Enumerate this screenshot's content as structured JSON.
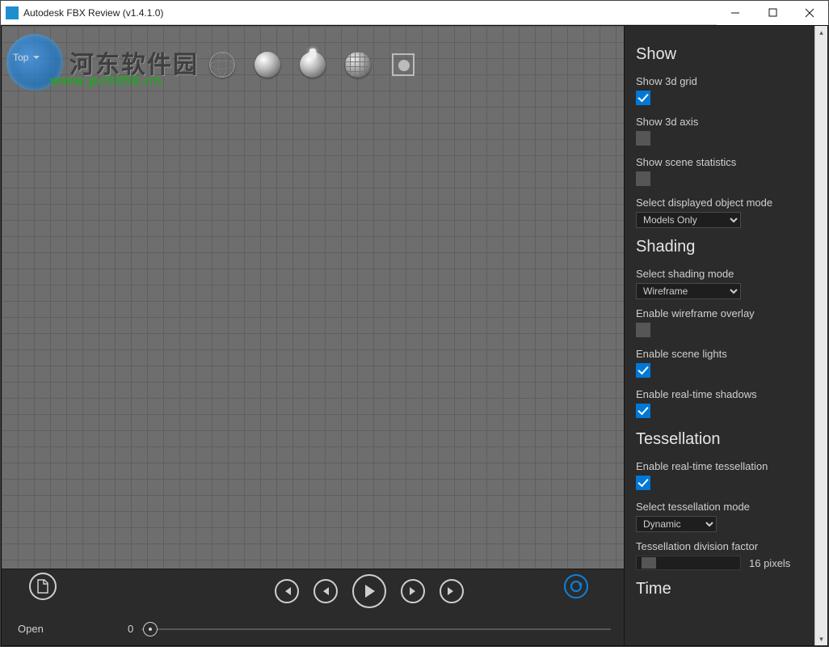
{
  "window": {
    "title": "Autodesk FBX Review (v1.4.1.0)"
  },
  "watermark": {
    "text": "河东软件园",
    "url": "www.pc0359.cn"
  },
  "viewportLabel": "Top",
  "toolbar": {
    "wireframe": "wireframe-sphere-icon",
    "shaded": "shaded-sphere-icon",
    "lit": "lit-sphere-icon",
    "textured": "textured-sphere-icon",
    "focus": "focus-icon"
  },
  "bottom": {
    "openLabel": "Open",
    "frame": "0"
  },
  "side": {
    "show": {
      "title": "Show",
      "grid": {
        "label": "Show 3d grid",
        "checked": true
      },
      "axis": {
        "label": "Show 3d axis",
        "checked": false
      },
      "stats": {
        "label": "Show scene statistics",
        "checked": false
      },
      "objmode": {
        "label": "Select displayed object mode",
        "value": "Models Only"
      }
    },
    "shading": {
      "title": "Shading",
      "mode": {
        "label": "Select shading mode",
        "value": "Wireframe"
      },
      "wf": {
        "label": "Enable wireframe overlay",
        "checked": false
      },
      "lights": {
        "label": "Enable scene lights",
        "checked": true
      },
      "shadows": {
        "label": "Enable real-time shadows",
        "checked": true
      }
    },
    "tess": {
      "title": "Tessellation",
      "enable": {
        "label": "Enable real-time tessellation",
        "checked": true
      },
      "mode": {
        "label": "Select tessellation mode",
        "value": "Dynamic"
      },
      "factor": {
        "label": "Tessellation division factor",
        "value": "16 pixels"
      }
    },
    "time": {
      "title": "Time"
    }
  }
}
